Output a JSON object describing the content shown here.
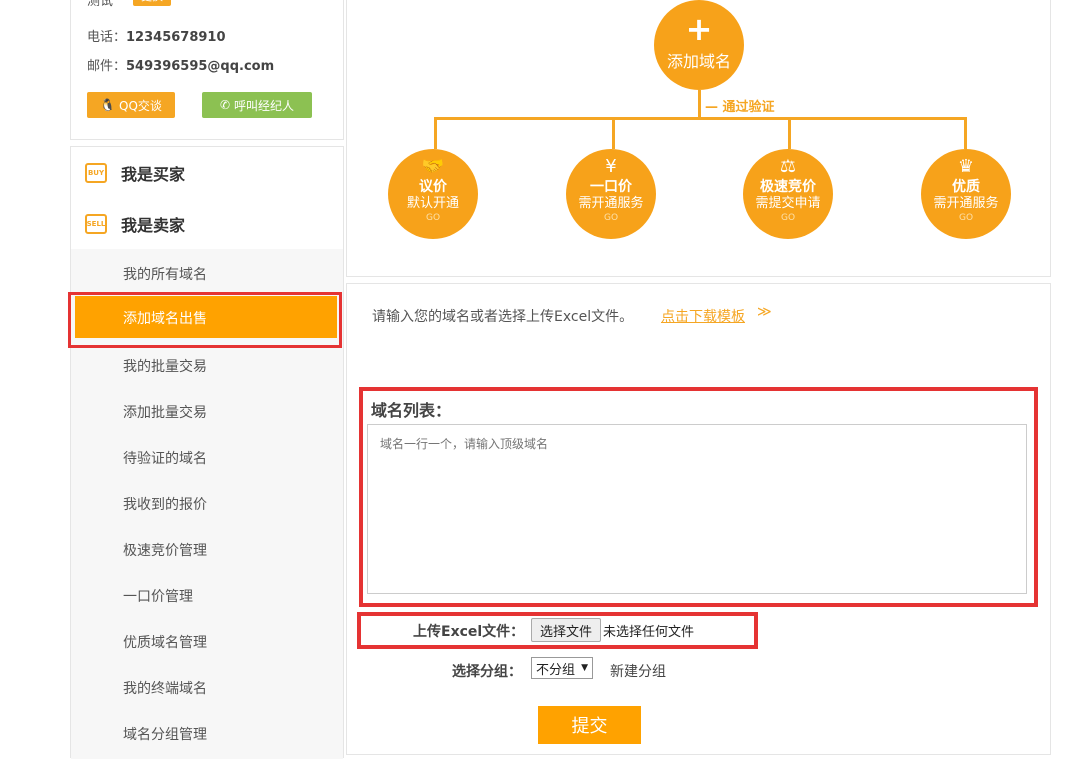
{
  "profile": {
    "name": "测试",
    "change_label": "更换",
    "phone_label": "电话：",
    "phone": "12345678910",
    "email_label": "邮件：",
    "email": "549396595@qq.com",
    "qq_button": "QQ交谈",
    "call_button": "呼叫经纪人"
  },
  "menu": {
    "buyer": {
      "icon": "BUY",
      "label": "我是买家"
    },
    "seller": {
      "icon": "SELL",
      "label": "我是卖家"
    },
    "items": [
      "我的所有域名",
      "添加域名出售",
      "我的批量交易",
      "添加批量交易",
      "待验证的域名",
      "我收到的报价",
      "极速竞价管理",
      "一口价管理",
      "优质域名管理",
      "我的终端域名",
      "域名分组管理"
    ],
    "active_index": 1
  },
  "diagram": {
    "center": {
      "icon": "+",
      "label": "添加域名"
    },
    "verify": "通过验证",
    "options": [
      {
        "icon": "handshake-icon",
        "glyph": "🤝",
        "title": "议价",
        "desc": "默认开通",
        "go": "GO"
      },
      {
        "icon": "price-tag-icon",
        "glyph": "¥",
        "title": "一口价",
        "desc": "需开通服务",
        "go": "GO"
      },
      {
        "icon": "gavel-icon",
        "glyph": "⚖",
        "title": "极速竞价",
        "desc": "需提交申请",
        "go": "GO"
      },
      {
        "icon": "crown-icon",
        "glyph": "♛",
        "title": "优质",
        "desc": "需开通服务",
        "go": "GO"
      }
    ]
  },
  "form": {
    "tip": "请输入您的域名或者选择上传Excel文件。",
    "download_link": "点击下载模板",
    "list_label": "域名列表：",
    "textarea_placeholder": "域名一行一个，请输入顶级域名",
    "upload_label": "上传Excel文件：",
    "file_button": "选择文件",
    "no_file": "未选择任何文件",
    "group_label": "选择分组：",
    "group_value": "不分组",
    "new_group": "新建分组",
    "submit": "提交"
  },
  "colors": {
    "accent": "#ffa200",
    "highlight": "#e53333",
    "green": "#8cc152"
  }
}
